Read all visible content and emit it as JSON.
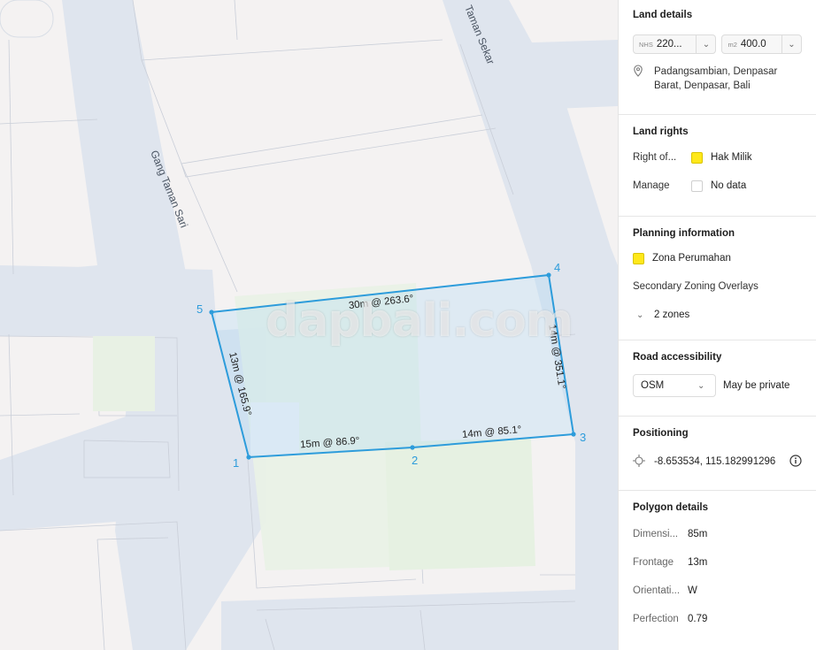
{
  "map": {
    "street_labels": [
      "Gang Taman Sari",
      "Taman Sekar"
    ],
    "watermark": "dapbali.com",
    "vertices": [
      "1",
      "2",
      "3",
      "4",
      "5"
    ],
    "edge_labels": [
      "30m @ 263.6°",
      "14m @ 351.1°",
      "14m @ 85.1°",
      "15m @ 86.9°",
      "13m @ 165.9°"
    ],
    "polygon_color": "#2d9cdb"
  },
  "panel": {
    "land_details": {
      "title": "Land details",
      "nhs_prefix": "NHS",
      "nhs_value": "220...",
      "area_prefix": "m2",
      "area_value": "400.0",
      "address": [
        "Padangsambian, Denpasar",
        "Barat, Denpasar, Bali"
      ]
    },
    "land_rights": {
      "title": "Land rights",
      "rows": [
        {
          "label": "Right of...",
          "value": "Hak Milik",
          "swatch": "#ffe81a"
        },
        {
          "label": "Manage",
          "value": "No data",
          "swatch": "none"
        }
      ]
    },
    "planning": {
      "title": "Planning information",
      "zone": "Zona Perumahan",
      "zone_color": "#ffe81a",
      "overlays_label": "Secondary Zoning Overlays",
      "zones_toggle": "2 zones"
    },
    "road": {
      "title": "Road accessibility",
      "select_value": "OSM",
      "note": "May be private"
    },
    "positioning": {
      "title": "Positioning",
      "coordinates": "-8.653534, 115.182991296"
    },
    "polygon": {
      "title": "Polygon details",
      "rows": [
        {
          "label": "Dimensi...",
          "value": "85m"
        },
        {
          "label": "Frontage",
          "value": "13m"
        },
        {
          "label": "Orientati...",
          "value": "W"
        },
        {
          "label": "Perfection",
          "value": "0.79"
        }
      ]
    }
  }
}
